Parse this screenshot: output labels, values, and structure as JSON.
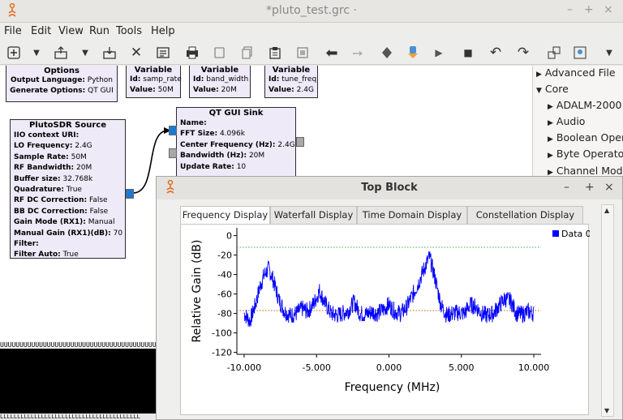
{
  "window": {
    "title": "*pluto_test.grc ·",
    "controls": [
      "–",
      "+",
      "×"
    ]
  },
  "menu": [
    "File",
    "Edit",
    "View",
    "Run",
    "Tools",
    "Help"
  ],
  "toolbar_icons": [
    "new-icon",
    "dropdown-arrow-icon",
    "open-icon",
    "dropdown-arrow-icon",
    "save-icon",
    "close-icon",
    "generate-icon",
    "print-icon",
    "copy-icon",
    "paste-icon",
    "clipboard-icon",
    "delete-icon",
    "undo-arrow-icon",
    "redo-arrow-icon",
    "kill-icon",
    "execute-icon",
    "run-icon",
    "stop-icon",
    "rotate-ccw-icon",
    "rotate-cw-icon",
    "find-icon",
    "search-icon",
    "more-icon"
  ],
  "blocks": {
    "options": {
      "title": "Options",
      "rows": [
        {
          "k": "Output Language:",
          "v": "Python"
        },
        {
          "k": "Generate Options:",
          "v": "QT GUI"
        }
      ]
    },
    "var1": {
      "title": "Variable",
      "id_k": "Id:",
      "id_v": "samp_rate",
      "val_k": "Value:",
      "val_v": "50M"
    },
    "var2": {
      "title": "Variable",
      "id_k": "Id:",
      "id_v": "band_width",
      "val_k": "Value:",
      "val_v": "20M"
    },
    "var3": {
      "title": "Variable",
      "id_k": "Id:",
      "id_v": "tune_freq",
      "val_k": "Value:",
      "val_v": "2.4G"
    },
    "pluto": {
      "title": "PlutoSDR Source",
      "rows": [
        {
          "k": "IIO context URI:",
          "v": ""
        },
        {
          "k": "LO Frequency:",
          "v": "2.4G"
        },
        {
          "k": "Sample Rate:",
          "v": "50M"
        },
        {
          "k": "RF Bandwidth:",
          "v": "20M"
        },
        {
          "k": "Buffer size:",
          "v": "32.768k"
        },
        {
          "k": "Quadrature:",
          "v": "True"
        },
        {
          "k": "RF DC Correction:",
          "v": "False"
        },
        {
          "k": "BB DC Correction:",
          "v": "False"
        },
        {
          "k": "Gain Mode (RX1):",
          "v": "Manual"
        },
        {
          "k": "Manual Gain (RX1)(dB):",
          "v": "70"
        },
        {
          "k": "Filter:",
          "v": ""
        },
        {
          "k": "Filter Auto:",
          "v": "True"
        }
      ]
    },
    "sink": {
      "title": "QT GUI Sink",
      "rows": [
        {
          "k": "Name:",
          "v": ""
        },
        {
          "k": "FFT Size:",
          "v": "4.096k"
        },
        {
          "k": "Center Frequency (Hz):",
          "v": "2.4G"
        },
        {
          "k": "Bandwidth (Hz):",
          "v": "20M"
        },
        {
          "k": "Update Rate:",
          "v": "10"
        }
      ]
    }
  },
  "tree": {
    "items": [
      {
        "arrow": "▶",
        "label": "Advanced File"
      },
      {
        "arrow": "▼",
        "label": "Core"
      },
      {
        "arrow": "▶",
        "label": "ADALM-2000"
      },
      {
        "arrow": "▶",
        "label": "Audio"
      },
      {
        "arrow": "▶",
        "label": "Boolean Operators"
      },
      {
        "arrow": "▶",
        "label": "Byte Operators"
      },
      {
        "arrow": "▶",
        "label": "Channel Models"
      }
    ]
  },
  "terminal": {
    "line_top": "UUUUUUUUUUUUUUUUUUUUUUUUUUUUUUUUUUUUUUUUU",
    "line_bottom": "LLLLLLLLLLLLLLLLLLLLLLLLLLLLLLLLLLLLLLLLL"
  },
  "top_block": {
    "title": "Top Block",
    "controls": [
      "–",
      "+",
      "×"
    ],
    "tabs": [
      "Frequency Display",
      "Waterfall Display",
      "Time Domain Display",
      "Constellation Display"
    ]
  },
  "chart_data": {
    "type": "line",
    "xlabel": "Frequency (MHz)",
    "ylabel": "Relative Gain (dB)",
    "xlim": [
      -10.5,
      10.5
    ],
    "ylim": [
      -122,
      8
    ],
    "x_ticks": [
      -10.0,
      -5.0,
      0.0,
      5.0,
      10.0
    ],
    "x_tick_labels": [
      "-10.000",
      "-5.000",
      "0.000",
      "5.000",
      "10.000"
    ],
    "y_ticks": [
      0,
      -20,
      -40,
      -60,
      -80,
      -100,
      -120
    ],
    "grid": false,
    "legend_position": "top-right",
    "colors": {
      "data": "#0000ff",
      "max_hold": "#3cb44b",
      "noise_ref": "#b45f00"
    },
    "reference_lines": [
      {
        "y": -12,
        "color": "#3cb44b",
        "style": "dotted"
      },
      {
        "y": -77,
        "color": "#b45f00",
        "style": "dotted"
      }
    ],
    "series": [
      {
        "name": "Data 0",
        "x": [
          -10.0,
          -9.6,
          -9.2,
          -8.9,
          -8.6,
          -8.3,
          -8.0,
          -7.6,
          -7.2,
          -6.8,
          -6.4,
          -6.0,
          -5.6,
          -5.2,
          -4.8,
          -4.4,
          -4.0,
          -3.6,
          -3.2,
          -2.8,
          -2.4,
          -2.0,
          -1.6,
          -1.2,
          -0.8,
          -0.4,
          0.0,
          0.4,
          0.8,
          1.2,
          1.6,
          2.0,
          2.4,
          2.8,
          3.2,
          3.6,
          4.0,
          4.4,
          4.8,
          5.2,
          5.6,
          6.0,
          6.4,
          6.8,
          7.2,
          7.6,
          8.0,
          8.4,
          8.8,
          9.2,
          9.6,
          10.0
        ],
        "y": [
          -80,
          -88,
          -70,
          -52,
          -40,
          -34,
          -45,
          -66,
          -78,
          -82,
          -80,
          -75,
          -78,
          -70,
          -57,
          -70,
          -80,
          -82,
          -80,
          -77,
          -68,
          -80,
          -81,
          -78,
          -80,
          -76,
          -71,
          -78,
          -80,
          -74,
          -62,
          -50,
          -35,
          -22,
          -45,
          -72,
          -82,
          -80,
          -79,
          -80,
          -71,
          -73,
          -80,
          -82,
          -80,
          -72,
          -65,
          -67,
          -80,
          -81,
          -78,
          -80
        ]
      }
    ]
  }
}
